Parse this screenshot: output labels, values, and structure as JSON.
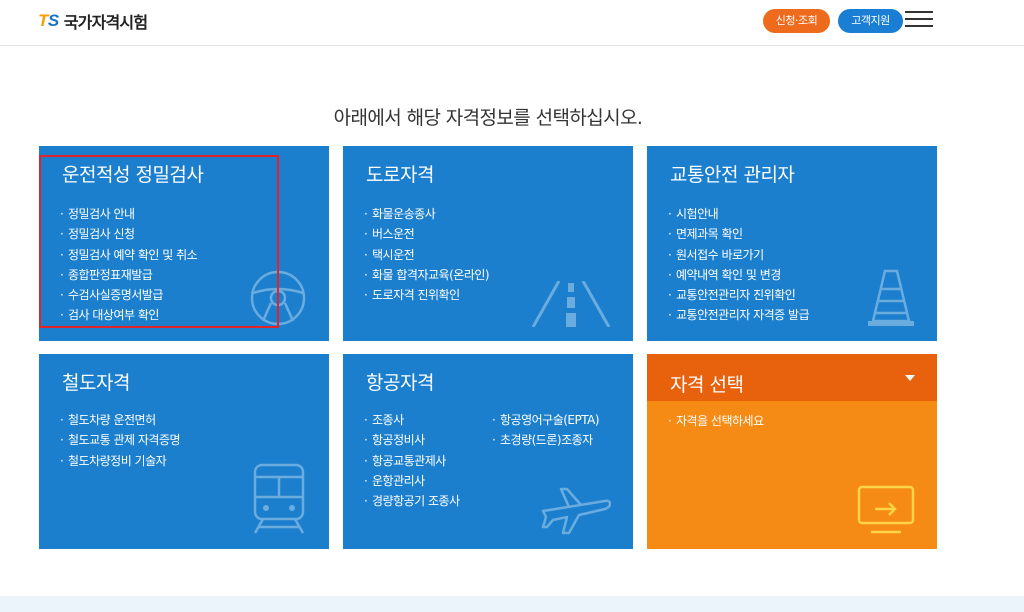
{
  "header": {
    "logo_mark_t": "T",
    "logo_mark_s": "S",
    "logo_name": "국가자격시험",
    "apply_label": "신청·조회",
    "support_label": "고객지원",
    "menu_icon": "hamburger-menu-icon"
  },
  "headline": "아래에서 해당 자격정보를 선택하십시오.",
  "cards": [
    {
      "title": "운전적성 정밀검사",
      "icon": "steering-wheel-icon",
      "items": [
        "정밀검사 안내",
        "정밀검사 신청",
        "정밀검사 예약 확인 및 취소",
        "종합판정표재발급",
        "수검사실증명서발급",
        "검사 대상여부 확인"
      ]
    },
    {
      "title": "도로자격",
      "icon": "road-icon",
      "items": [
        "화물운송종사",
        "버스운전",
        "택시운전",
        "화물 합격자교육(온라인)",
        "도로자격 진위확인"
      ]
    },
    {
      "title": "교통안전 관리자",
      "icon": "traffic-cone-icon",
      "items": [
        "시험안내",
        "면제과목 확인",
        "원서접수 바로가기",
        "예약내역 확인 및 변경",
        "교통안전관리자 진위확인",
        "교통안전관리자 자격증 발급"
      ]
    },
    {
      "title": "철도자격",
      "icon": "train-icon",
      "items": [
        "철도차량 운전면허",
        "철도교통 관제 자격증명",
        "철도차량정비 기술자"
      ]
    },
    {
      "title": "항공자격",
      "icon": "airplane-icon",
      "items_col1": [
        "조종사",
        "항공정비사",
        "항공교통관제사",
        "운항관리사",
        "경량항공기 조종사"
      ],
      "items_col2": [
        "항공영어구술(EPTA)",
        "초경량(드론)조종자"
      ]
    },
    {
      "title": "자격 선택",
      "icon": "monitor-icon",
      "caret_icon": "chevron-down-icon",
      "items": [
        "자격을 선택하세요"
      ]
    }
  ],
  "colors": {
    "card_blue": "#1b7fce",
    "card_orange": "#f58b14",
    "card_orange_head": "#e8620e",
    "pill_orange": "#ee6a1c",
    "pill_blue": "#1a7fd4",
    "highlight_red": "#e2232a"
  }
}
